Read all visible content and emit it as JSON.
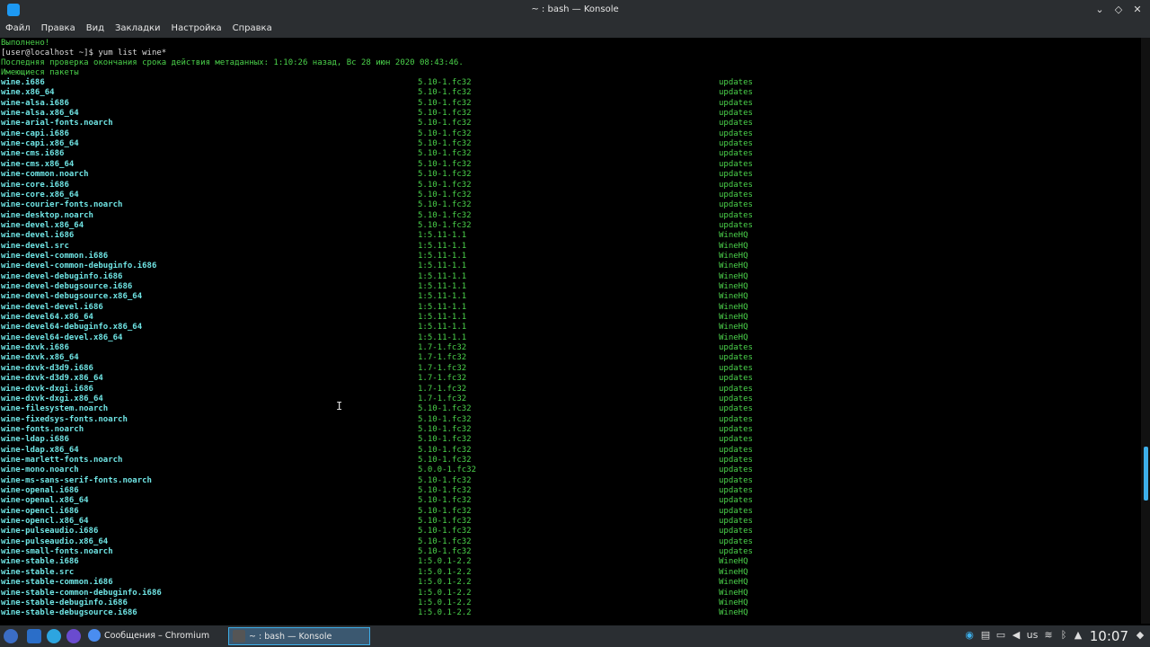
{
  "window": {
    "title": "~ : bash — Konsole"
  },
  "menu": [
    "Файл",
    "Правка",
    "Вид",
    "Закладки",
    "Настройка",
    "Справка"
  ],
  "terminal": {
    "header_lines": [
      "Выполнено!",
      "[user@localhost ~]$ yum list wine*",
      "Последняя проверка окончания срока действия метаданных: 1:10:26 назад, Вс 28 июн 2020 08:43:46.",
      "Имеющиеся пакеты"
    ],
    "packages": [
      [
        "wine.i686",
        "5.10-1.fc32",
        "updates"
      ],
      [
        "wine.x86_64",
        "5.10-1.fc32",
        "updates"
      ],
      [
        "wine-alsa.i686",
        "5.10-1.fc32",
        "updates"
      ],
      [
        "wine-alsa.x86_64",
        "5.10-1.fc32",
        "updates"
      ],
      [
        "wine-arial-fonts.noarch",
        "5.10-1.fc32",
        "updates"
      ],
      [
        "wine-capi.i686",
        "5.10-1.fc32",
        "updates"
      ],
      [
        "wine-capi.x86_64",
        "5.10-1.fc32",
        "updates"
      ],
      [
        "wine-cms.i686",
        "5.10-1.fc32",
        "updates"
      ],
      [
        "wine-cms.x86_64",
        "5.10-1.fc32",
        "updates"
      ],
      [
        "wine-common.noarch",
        "5.10-1.fc32",
        "updates"
      ],
      [
        "wine-core.i686",
        "5.10-1.fc32",
        "updates"
      ],
      [
        "wine-core.x86_64",
        "5.10-1.fc32",
        "updates"
      ],
      [
        "wine-courier-fonts.noarch",
        "5.10-1.fc32",
        "updates"
      ],
      [
        "wine-desktop.noarch",
        "5.10-1.fc32",
        "updates"
      ],
      [
        "wine-devel.x86_64",
        "5.10-1.fc32",
        "updates"
      ],
      [
        "wine-devel.i686",
        "1:5.11-1.1",
        "WineHQ"
      ],
      [
        "wine-devel.src",
        "1:5.11-1.1",
        "WineHQ"
      ],
      [
        "wine-devel-common.i686",
        "1:5.11-1.1",
        "WineHQ"
      ],
      [
        "wine-devel-common-debuginfo.i686",
        "1:5.11-1.1",
        "WineHQ"
      ],
      [
        "wine-devel-debuginfo.i686",
        "1:5.11-1.1",
        "WineHQ"
      ],
      [
        "wine-devel-debugsource.i686",
        "1:5.11-1.1",
        "WineHQ"
      ],
      [
        "wine-devel-debugsource.x86_64",
        "1:5.11-1.1",
        "WineHQ"
      ],
      [
        "wine-devel-devel.i686",
        "1:5.11-1.1",
        "WineHQ"
      ],
      [
        "wine-devel64.x86_64",
        "1:5.11-1.1",
        "WineHQ"
      ],
      [
        "wine-devel64-debuginfo.x86_64",
        "1:5.11-1.1",
        "WineHQ"
      ],
      [
        "wine-devel64-devel.x86_64",
        "1:5.11-1.1",
        "WineHQ"
      ],
      [
        "wine-dxvk.i686",
        "1.7-1.fc32",
        "updates"
      ],
      [
        "wine-dxvk.x86_64",
        "1.7-1.fc32",
        "updates"
      ],
      [
        "wine-dxvk-d3d9.i686",
        "1.7-1.fc32",
        "updates"
      ],
      [
        "wine-dxvk-d3d9.x86_64",
        "1.7-1.fc32",
        "updates"
      ],
      [
        "wine-dxvk-dxgi.i686",
        "1.7-1.fc32",
        "updates"
      ],
      [
        "wine-dxvk-dxgi.x86_64",
        "1.7-1.fc32",
        "updates"
      ],
      [
        "wine-filesystem.noarch",
        "5.10-1.fc32",
        "updates"
      ],
      [
        "wine-fixedsys-fonts.noarch",
        "5.10-1.fc32",
        "updates"
      ],
      [
        "wine-fonts.noarch",
        "5.10-1.fc32",
        "updates"
      ],
      [
        "wine-ldap.i686",
        "5.10-1.fc32",
        "updates"
      ],
      [
        "wine-ldap.x86_64",
        "5.10-1.fc32",
        "updates"
      ],
      [
        "wine-marlett-fonts.noarch",
        "5.10-1.fc32",
        "updates"
      ],
      [
        "wine-mono.noarch",
        "5.0.0-1.fc32",
        "updates"
      ],
      [
        "wine-ms-sans-serif-fonts.noarch",
        "5.10-1.fc32",
        "updates"
      ],
      [
        "wine-openal.i686",
        "5.10-1.fc32",
        "updates"
      ],
      [
        "wine-openal.x86_64",
        "5.10-1.fc32",
        "updates"
      ],
      [
        "wine-opencl.i686",
        "5.10-1.fc32",
        "updates"
      ],
      [
        "wine-opencl.x86_64",
        "5.10-1.fc32",
        "updates"
      ],
      [
        "wine-pulseaudio.i686",
        "5.10-1.fc32",
        "updates"
      ],
      [
        "wine-pulseaudio.x86_64",
        "5.10-1.fc32",
        "updates"
      ],
      [
        "wine-small-fonts.noarch",
        "5.10-1.fc32",
        "updates"
      ],
      [
        "wine-stable.i686",
        "1:5.0.1-2.2",
        "WineHQ"
      ],
      [
        "wine-stable.src",
        "1:5.0.1-2.2",
        "WineHQ"
      ],
      [
        "wine-stable-common.i686",
        "1:5.0.1-2.2",
        "WineHQ"
      ],
      [
        "wine-stable-common-debuginfo.i686",
        "1:5.0.1-2.2",
        "WineHQ"
      ],
      [
        "wine-stable-debuginfo.i686",
        "1:5.0.1-2.2",
        "WineHQ"
      ],
      [
        "wine-stable-debugsource.i686",
        "1:5.0.1-2.2",
        "WineHQ"
      ]
    ]
  },
  "taskbar": {
    "tasks": [
      {
        "label": "Сообщения – Chromium",
        "icon": "chromium-icon"
      },
      {
        "label": "~ : bash — Konsole",
        "icon": "konsole-icon"
      }
    ],
    "keyboard_layout": "us",
    "clock": "10:07"
  },
  "colors": {
    "package_name": "#6fe4e4",
    "text_green": "#4bd34b",
    "panel": "#2a2e32",
    "active_task": "#3b5870"
  }
}
